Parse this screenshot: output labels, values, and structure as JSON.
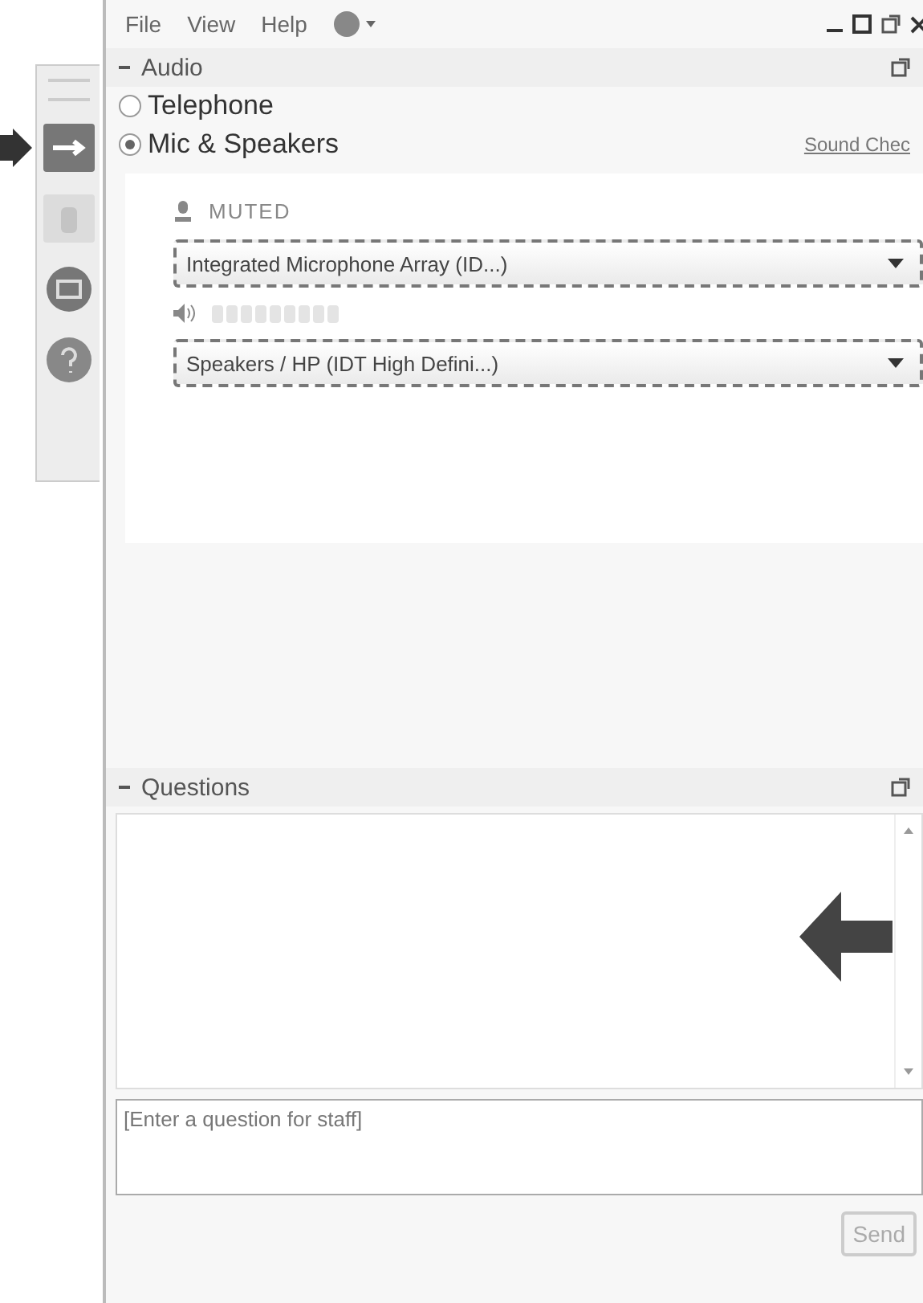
{
  "menu": [
    "File",
    "View",
    "Help"
  ],
  "audio": {
    "title": "Audio",
    "options": [
      {
        "label": "Telephone",
        "selected": false
      },
      {
        "label": "Mic & Speakers",
        "selected": true
      }
    ],
    "sound_check": "Sound Chec",
    "mic_status": "MUTED",
    "microphone": {
      "value": "Integrated Microphone Array (ID...)"
    },
    "speaker_meter": {
      "level": 0
    },
    "speakers": {
      "value": "Speakers / HP (IDT High Defini...)"
    }
  },
  "questions": {
    "title": "Questions",
    "input": {
      "placeholder": "[Enter a question for staff]"
    },
    "send": "Send"
  }
}
